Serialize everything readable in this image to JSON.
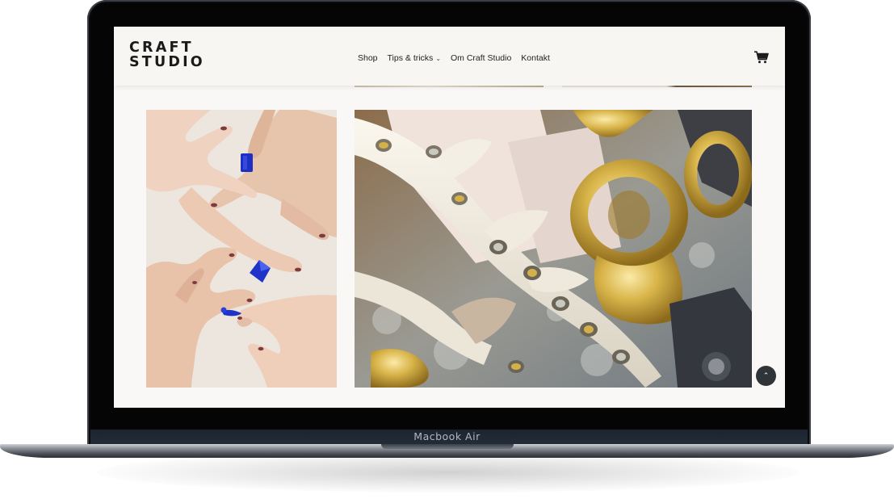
{
  "device": {
    "model_label": "Macbook Air"
  },
  "site": {
    "logo_line1": "CRAFT",
    "logo_line2": "STUDIO",
    "nav": [
      {
        "label": "Shop",
        "has_dropdown": false
      },
      {
        "label": "Tips & tricks",
        "has_dropdown": true
      },
      {
        "label": "Om Craft Studio",
        "has_dropdown": false
      },
      {
        "label": "Kontakt",
        "has_dropdown": false
      }
    ],
    "cart_icon": "cart-icon",
    "scroll_top_icon": "chevron-up-icon"
  },
  "colors": {
    "header_bg": "#f8f6f3",
    "screen_bg": "#faf8f6",
    "accent_blue": "#1f33c8",
    "gold": "#c9a43a",
    "button_dark": "#2f3438"
  }
}
